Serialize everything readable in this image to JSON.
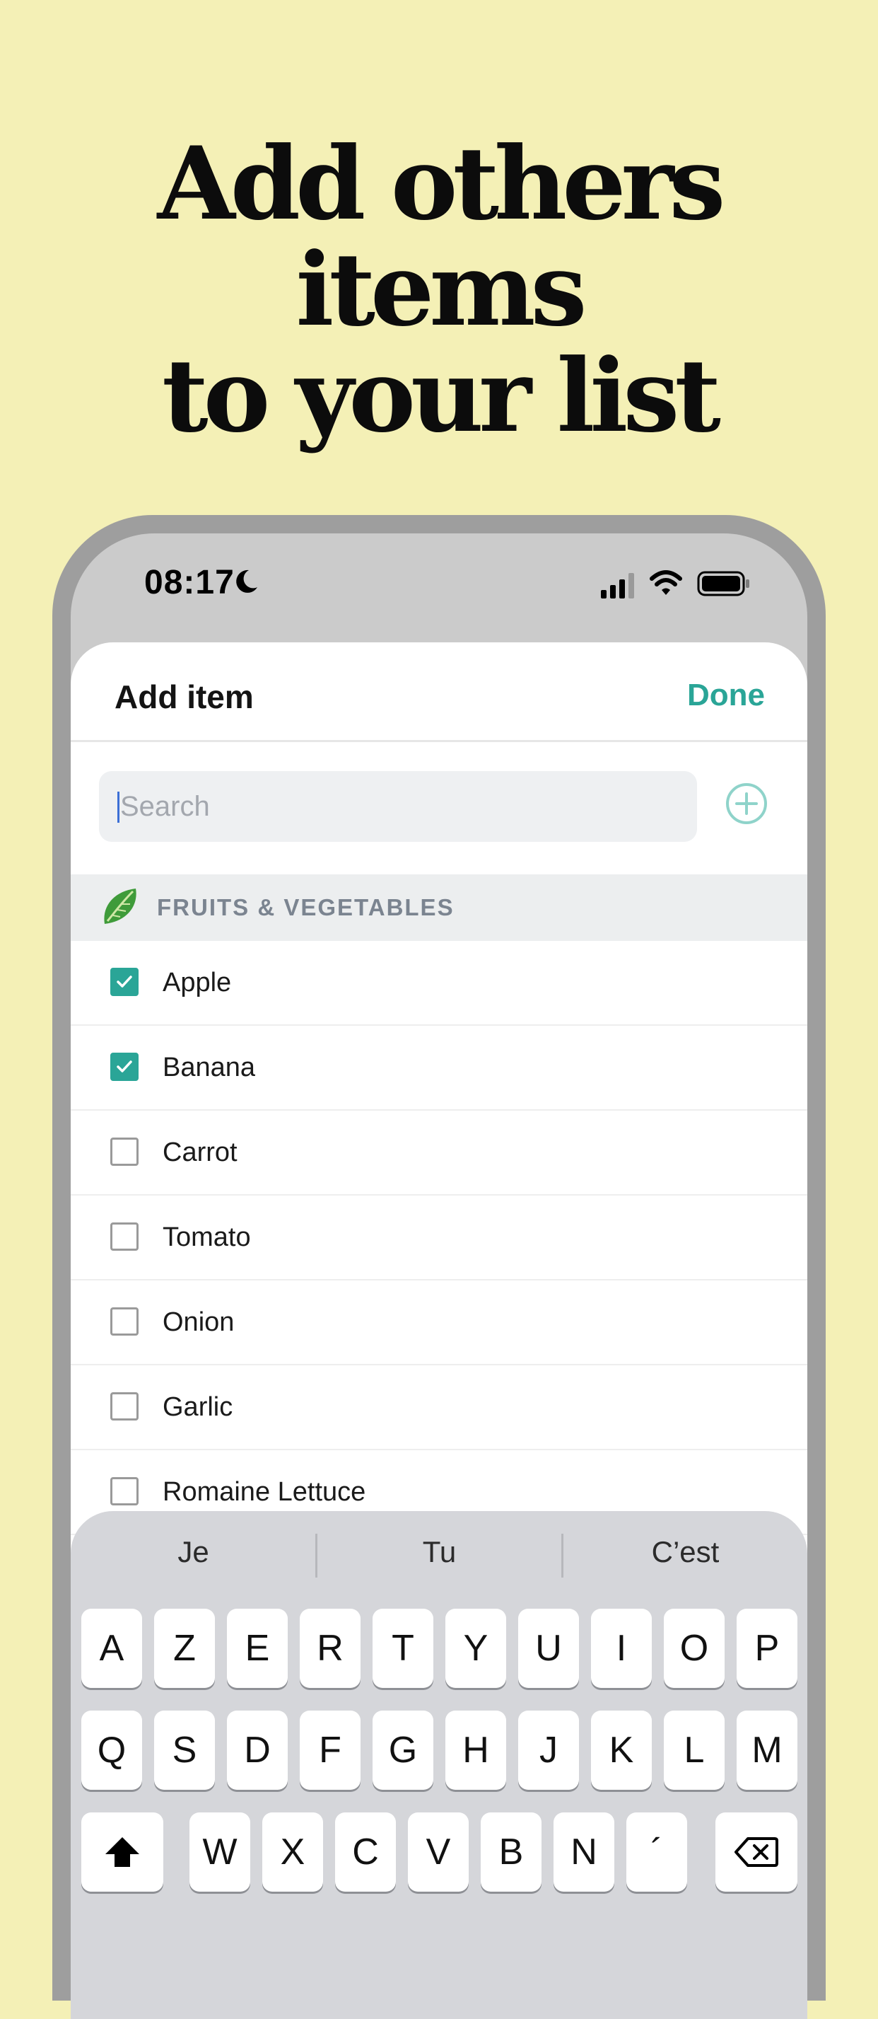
{
  "headline": {
    "line1": "Add others items",
    "line2": "to your list"
  },
  "status_bar": {
    "time": "08:17",
    "icons": [
      "moon-icon",
      "cellular-signal-icon",
      "wifi-icon",
      "battery-icon"
    ]
  },
  "sheet": {
    "title": "Add item",
    "done_label": "Done",
    "search": {
      "placeholder": "Search",
      "value": ""
    },
    "add_icon": "plus-circle-icon"
  },
  "category": {
    "icon": "lettuce-leaf-icon",
    "label": "FRUITS & VEGETABLES"
  },
  "items": [
    {
      "label": "Apple",
      "checked": true
    },
    {
      "label": "Banana",
      "checked": true
    },
    {
      "label": "Carrot",
      "checked": false
    },
    {
      "label": "Tomato",
      "checked": false
    },
    {
      "label": "Onion",
      "checked": false
    },
    {
      "label": "Garlic",
      "checked": false
    },
    {
      "label": "Romaine Lettuce",
      "checked": false
    }
  ],
  "keyboard": {
    "suggestions": [
      "Je",
      "Tu",
      "C’est"
    ],
    "row1": [
      "A",
      "Z",
      "E",
      "R",
      "T",
      "Y",
      "U",
      "I",
      "O",
      "P"
    ],
    "row2": [
      "Q",
      "S",
      "D",
      "F",
      "G",
      "H",
      "J",
      "K",
      "L",
      "M"
    ],
    "row3": [
      "W",
      "X",
      "C",
      "V",
      "B",
      "N",
      "´"
    ],
    "shift_icon": "shift-icon",
    "backspace_icon": "backspace-icon"
  },
  "colors": {
    "background": "#F4F0B6",
    "accent": "#2AA597",
    "category_text": "#7B8490"
  }
}
